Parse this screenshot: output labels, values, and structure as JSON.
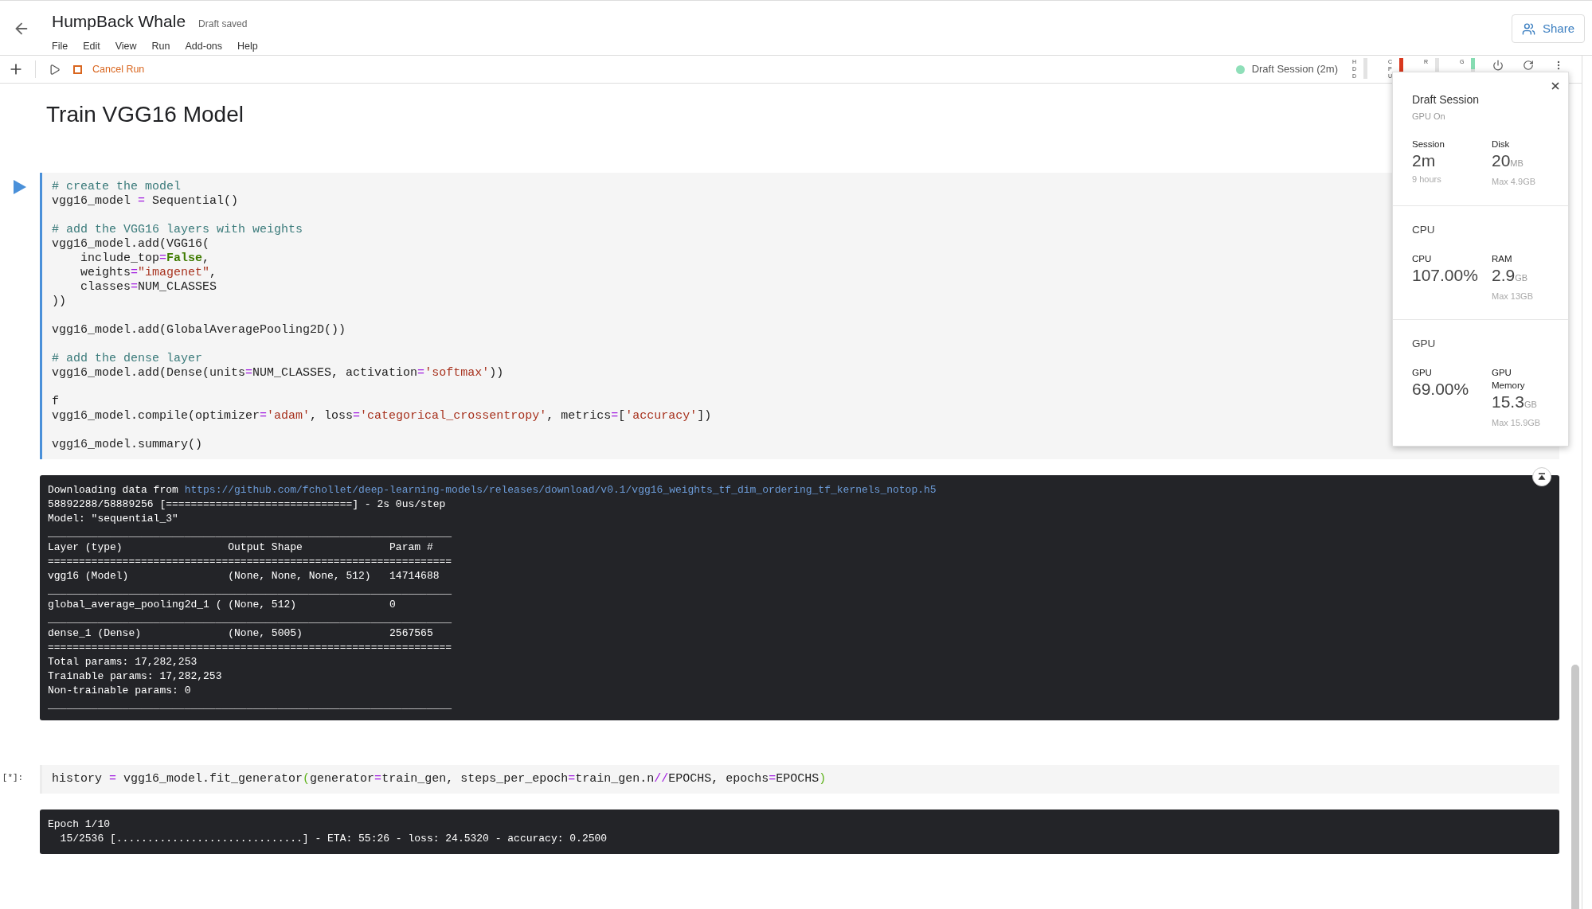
{
  "header": {
    "title": "HumpBack Whale",
    "status": "Draft saved",
    "menu": [
      "File",
      "Edit",
      "View",
      "Run",
      "Add-ons",
      "Help"
    ],
    "share": "Share"
  },
  "toolbar": {
    "cancel": "Cancel Run",
    "session": "Draft Session (2m)",
    "meters": [
      {
        "label": "HDD"
      },
      {
        "label": "CPU",
        "level": 1,
        "color": "#d9381e"
      },
      {
        "label": "R"
      },
      {
        "label": "G",
        "level": 0.55,
        "color": "#86dcb2"
      }
    ]
  },
  "heading": "Train VGG16 Model",
  "cells": [
    {
      "kind": "run",
      "selected": true,
      "blocks": [
        [
          [
            {
              "text": "# create the model",
              "kind": "comment"
            }
          ],
          [
            {
              "text": "vgg16_model ",
              "kind": "plain"
            },
            {
              "text": "=",
              "kind": "op"
            },
            {
              "text": " Sequential()",
              "kind": "plain"
            }
          ]
        ],
        [
          [
            {
              "text": "# add the VGG16 layers with weights",
              "kind": "comment"
            }
          ],
          [
            {
              "text": "vgg16_model.add(VGG16(",
              "kind": "plain"
            }
          ],
          [
            {
              "text": "    include_top",
              "kind": "plain"
            },
            {
              "text": "=",
              "kind": "op"
            },
            {
              "text": "False",
              "kind": "kw"
            },
            {
              "text": ",",
              "kind": "plain"
            }
          ],
          [
            {
              "text": "    weights",
              "kind": "plain"
            },
            {
              "text": "=",
              "kind": "op"
            },
            {
              "text": "\"imagenet\"",
              "kind": "str"
            },
            {
              "text": ",",
              "kind": "plain"
            }
          ],
          [
            {
              "text": "    classes",
              "kind": "plain"
            },
            {
              "text": "=",
              "kind": "op"
            },
            {
              "text": "NUM_CLASSES",
              "kind": "plain"
            }
          ],
          [
            {
              "text": "))",
              "kind": "plain"
            }
          ]
        ],
        [
          [
            {
              "text": "vgg16_model.add(GlobalAveragePooling2D())",
              "kind": "plain"
            }
          ]
        ],
        [
          [
            {
              "text": "# add the dense layer",
              "kind": "comment"
            }
          ],
          [
            {
              "text": "vgg16_model.add(Dense(units",
              "kind": "plain"
            },
            {
              "text": "=",
              "kind": "op"
            },
            {
              "text": "NUM_CLASSES, activation",
              "kind": "plain"
            },
            {
              "text": "=",
              "kind": "op"
            },
            {
              "text": "'softmax'",
              "kind": "str"
            },
            {
              "text": "))",
              "kind": "plain"
            }
          ]
        ],
        [
          [
            {
              "text": "f",
              "kind": "plain"
            }
          ],
          [
            {
              "text": "vgg16_model.compile(optimizer",
              "kind": "plain"
            },
            {
              "text": "=",
              "kind": "op"
            },
            {
              "text": "'adam'",
              "kind": "str"
            },
            {
              "text": ", loss",
              "kind": "plain"
            },
            {
              "text": "=",
              "kind": "op"
            },
            {
              "text": "'categorical_crossentropy'",
              "kind": "str"
            },
            {
              "text": ", metrics",
              "kind": "plain"
            },
            {
              "text": "=",
              "kind": "op"
            },
            {
              "text": "[",
              "kind": "plain"
            },
            {
              "text": "'accuracy'",
              "kind": "str"
            },
            {
              "text": "])",
              "kind": "plain"
            }
          ]
        ],
        [
          [
            {
              "text": "vgg16_model.summary()",
              "kind": "plain"
            }
          ]
        ]
      ],
      "output": [
        {
          "text": "Downloading data from ",
          "link": "https://github.com/fchollet/deep-learning-models/releases/download/v0.1/vgg16_weights_tf_dim_ordering_tf_kernels_notop.h5"
        },
        {
          "text": "58892288/58889256 [==============================] - 2s 0us/step"
        },
        {
          "text": "Model: \"sequential_3\""
        },
        {
          "text": "_________________________________________________________________"
        },
        {
          "text": "Layer (type)                 Output Shape              Param #   "
        },
        {
          "text": "================================================================="
        },
        {
          "text": "vgg16 (Model)                (None, None, None, 512)   14714688  "
        },
        {
          "text": "_________________________________________________________________"
        },
        {
          "text": "global_average_pooling2d_1 ( (None, 512)               0         "
        },
        {
          "text": "_________________________________________________________________"
        },
        {
          "text": "dense_1 (Dense)              (None, 5005)              2567565   "
        },
        {
          "text": "================================================================="
        },
        {
          "text": "Total params: 17,282,253"
        },
        {
          "text": "Trainable params: 17,282,253"
        },
        {
          "text": "Non-trainable params: 0"
        },
        {
          "text": "_________________________________________________________________"
        }
      ]
    },
    {
      "kind": "label",
      "prompt": "[*]:",
      "selected": false,
      "blocks": [
        [
          [
            {
              "text": "history ",
              "kind": "plain"
            },
            {
              "text": "=",
              "kind": "op"
            },
            {
              "text": " vgg16_model.fit_generator",
              "kind": "plain"
            },
            {
              "text": "(",
              "kind": "paren"
            },
            {
              "text": "generator",
              "kind": "plain"
            },
            {
              "text": "=",
              "kind": "op"
            },
            {
              "text": "train_gen, steps_per_epoch",
              "kind": "plain"
            },
            {
              "text": "=",
              "kind": "op"
            },
            {
              "text": "train_gen.n",
              "kind": "plain"
            },
            {
              "text": "//",
              "kind": "op"
            },
            {
              "text": "EPOCHS, epochs",
              "kind": "plain"
            },
            {
              "text": "=",
              "kind": "op"
            },
            {
              "text": "EPOCHS",
              "kind": "plain"
            },
            {
              "text": ")",
              "kind": "paren"
            }
          ]
        ]
      ],
      "output": [
        {
          "text": "Epoch 1/10"
        },
        {
          "text": "  15/2536 [..............................] - ETA: 55:26 - loss: 24.5320 - accuracy: 0.2500"
        }
      ]
    }
  ],
  "popup": {
    "title": "Draft Session",
    "subtitle": "GPU On",
    "sections": [
      {
        "stats": [
          {
            "label": "Session",
            "value": "2m",
            "note": "9 hours"
          },
          {
            "label": "Disk",
            "value": "20",
            "unit": "MB",
            "note": "Max 4.9GB"
          }
        ]
      },
      {
        "heading": "CPU",
        "stats": [
          {
            "label": "CPU",
            "value": "107.00%"
          },
          {
            "label": "RAM",
            "value": "2.9",
            "unit": "GB",
            "note": "Max 13GB"
          }
        ]
      },
      {
        "heading": "GPU",
        "stats": [
          {
            "label": "GPU",
            "value": "69.00%"
          },
          {
            "label": "GPU Memory",
            "value": "15.3",
            "unit": "GB",
            "note": "Max 15.9GB"
          }
        ]
      }
    ]
  }
}
